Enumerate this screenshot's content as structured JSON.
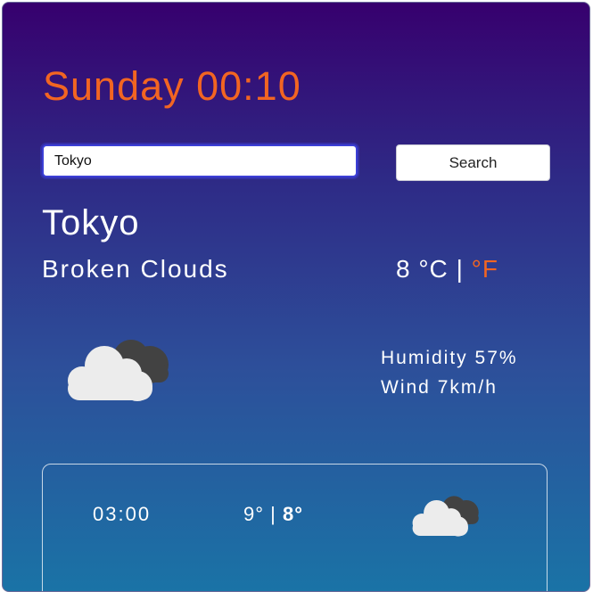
{
  "header": {
    "datetime": "Sunday 00:10"
  },
  "search": {
    "value": "Tokyo",
    "button_label": "Search"
  },
  "current": {
    "city": "Tokyo",
    "description": "Broken Clouds",
    "temp_value": "8",
    "unit_celsius": "°C",
    "unit_separator": "|",
    "unit_fahrenheit": "°F",
    "icon": "broken-clouds-icon",
    "humidity_label": "Humidity",
    "humidity_value": "57%",
    "wind_label": "Wind",
    "wind_value": "7km/h"
  },
  "forecast": [
    {
      "time": "03:00",
      "temp_max": "9°",
      "separator": "|",
      "temp_min": "8°",
      "icon": "broken-clouds-icon"
    }
  ],
  "colors": {
    "accent": "#f26522",
    "gradient_top": "#37006e",
    "gradient_bottom": "#1a73a6",
    "text": "#ffffff"
  }
}
